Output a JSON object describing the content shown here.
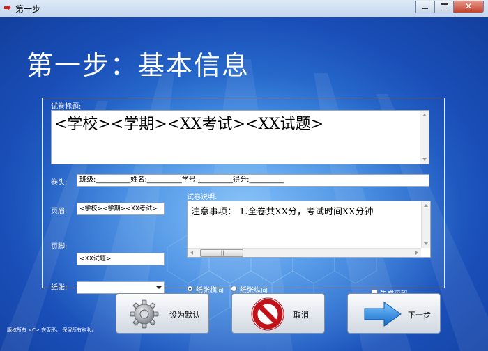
{
  "window": {
    "title": "第一步",
    "minimize_icon": "minimize-icon",
    "maximize_icon": "maximize-icon",
    "close_icon": "close-icon"
  },
  "heading": "第一步：基本信息",
  "exam_title": {
    "label": "试卷标题:",
    "value": "<学校><学期><XX考试><XX试题>"
  },
  "header_field": {
    "label": "卷头:",
    "value": "班级:__________姓名:__________学号:__________得分:__________"
  },
  "page_header": {
    "label": "页眉:",
    "value": "<学校><学期><XX考试>"
  },
  "page_footer": {
    "label": "页脚:",
    "value": "<XX试题>"
  },
  "exam_notes": {
    "label": "试卷说明:",
    "value": "注意事项：  1.全卷共XX分，考试时间XX分钟"
  },
  "paper": {
    "label": "纸张:",
    "selected": ""
  },
  "orientation": {
    "landscape_label": "纸张横向",
    "portrait_label": "纸张纵向",
    "selected": "landscape"
  },
  "page_numbers": {
    "label": "生成页码",
    "checked": false
  },
  "buttons": {
    "set_default": {
      "label": "设为默认",
      "icon": "gear-icon"
    },
    "cancel": {
      "label": "取消",
      "icon": "no-entry-icon"
    },
    "next": {
      "label": "下一步",
      "icon": "arrow-right-icon"
    }
  },
  "footer_copyright": "版权所有 <C> 安否形。 保留所有权利。",
  "colors": {
    "background": "#1f5fc4",
    "cancel_red": "#c2121a",
    "next_blue": "#1e8de6"
  }
}
